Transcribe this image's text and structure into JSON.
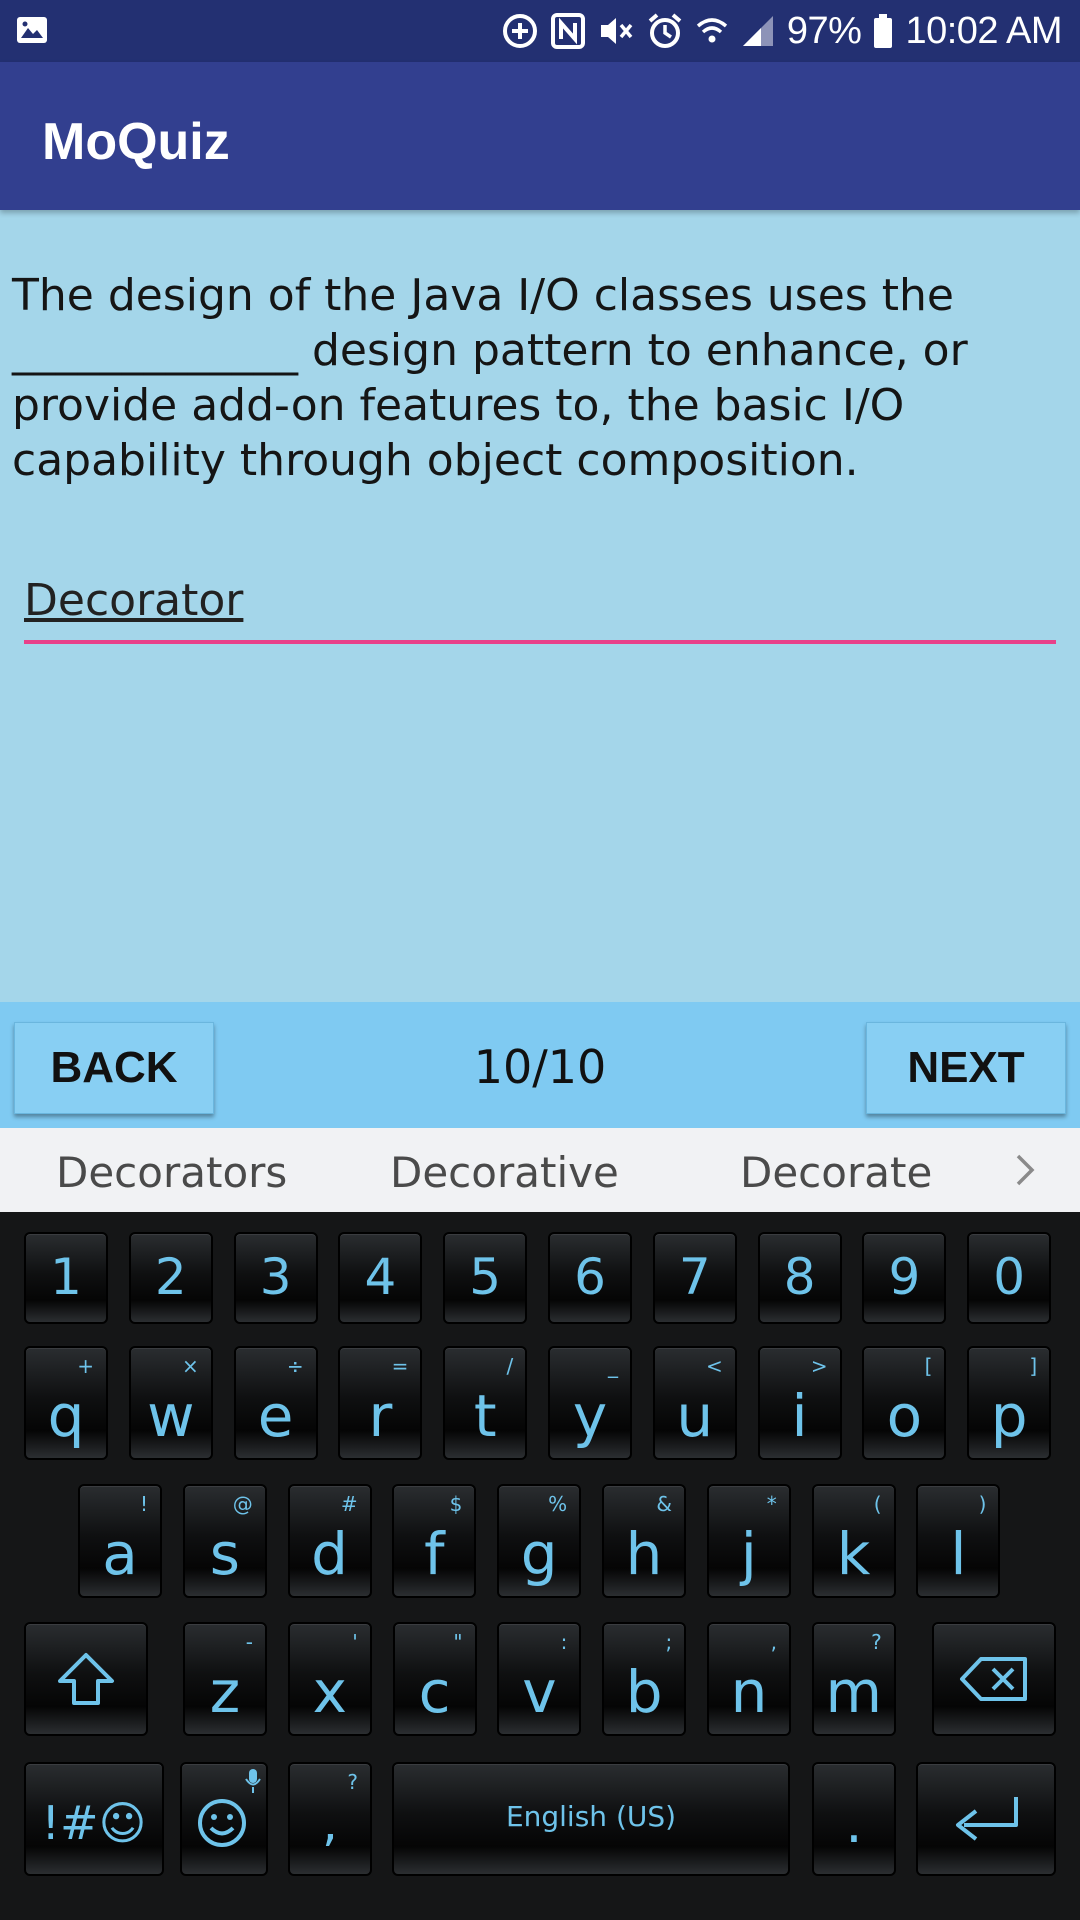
{
  "status_bar": {
    "battery_percent": "97%",
    "time": "10:02 AM"
  },
  "app_bar": {
    "title": "MoQuiz"
  },
  "question": {
    "text": "The design of the Java I/O classes uses the _____________ design pattern to enhance, or provide add-on features to, the basic I/O capability through object composition."
  },
  "answer": {
    "value": "Decorator"
  },
  "navigation": {
    "back_label": "BACK",
    "progress": "10/10",
    "next_label": "NEXT"
  },
  "suggestions": [
    "Decorators",
    "Decorative",
    "Decorate"
  ],
  "keyboard": {
    "number_row": [
      "1",
      "2",
      "3",
      "4",
      "5",
      "6",
      "7",
      "8",
      "9",
      "0"
    ],
    "row1": [
      {
        "k": "q",
        "s": "+"
      },
      {
        "k": "w",
        "s": "×"
      },
      {
        "k": "e",
        "s": "÷"
      },
      {
        "k": "r",
        "s": "="
      },
      {
        "k": "t",
        "s": "/"
      },
      {
        "k": "y",
        "s": "_"
      },
      {
        "k": "u",
        "s": "<"
      },
      {
        "k": "i",
        "s": ">"
      },
      {
        "k": "o",
        "s": "["
      },
      {
        "k": "p",
        "s": "]"
      }
    ],
    "row2": [
      {
        "k": "a",
        "s": "!"
      },
      {
        "k": "s",
        "s": "@"
      },
      {
        "k": "d",
        "s": "#"
      },
      {
        "k": "f",
        "s": "$"
      },
      {
        "k": "g",
        "s": "%"
      },
      {
        "k": "h",
        "s": "&"
      },
      {
        "k": "j",
        "s": "*"
      },
      {
        "k": "k",
        "s": "("
      },
      {
        "k": "l",
        "s": ")"
      }
    ],
    "row3": [
      {
        "k": "z",
        "s": "-"
      },
      {
        "k": "x",
        "s": "'"
      },
      {
        "k": "c",
        "s": "\""
      },
      {
        "k": "v",
        "s": ":"
      },
      {
        "k": "b",
        "s": ";"
      },
      {
        "k": "n",
        "s": ","
      },
      {
        "k": "m",
        "s": "?"
      }
    ],
    "symbols_label": "!#☺",
    "comma": {
      "k": ",",
      "s": "?"
    },
    "space_label": "English (US)",
    "period": ".",
    "icons": {
      "shift": "shift-icon",
      "backspace": "backspace-icon",
      "emoji": "emoji-icon",
      "mic": "mic-icon",
      "enter": "enter-icon"
    }
  },
  "colors": {
    "status_bar": "#233072",
    "app_bar": "#323f8f",
    "content_bg": "#a4d6ea",
    "nav_bg": "#7fcaf2",
    "accent_underline": "#e8418a",
    "key_text": "#6ec3ea"
  }
}
